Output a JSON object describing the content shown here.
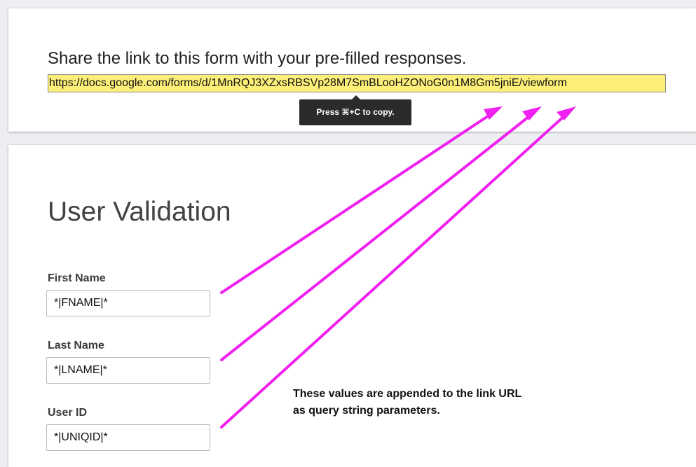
{
  "share_card": {
    "heading": "Share the link to this form with your pre-filled responses.",
    "link": "https://docs.google.com/forms/d/1MnRQJ3XZxsRBSVp28M7SmBLooHZONoG0n1M8Gm5jniE/viewform",
    "copy_tooltip": "Press ⌘+C to copy."
  },
  "form": {
    "title": "User Validation",
    "fields": [
      {
        "label": "First Name",
        "value": "*|FNAME|*"
      },
      {
        "label": "Last Name",
        "value": "*|LNAME|*"
      },
      {
        "label": "User ID",
        "value": "*|UNIQID|*"
      }
    ]
  },
  "annotation": {
    "lines": [
      "These values are appended to the link URL",
      "as query string parameters."
    ],
    "arrow_color": "#f020f0"
  },
  "colors": {
    "page_background": "#eceef1",
    "link_highlight": "#fcef79",
    "tooltip_background": "#2b2b2b"
  }
}
